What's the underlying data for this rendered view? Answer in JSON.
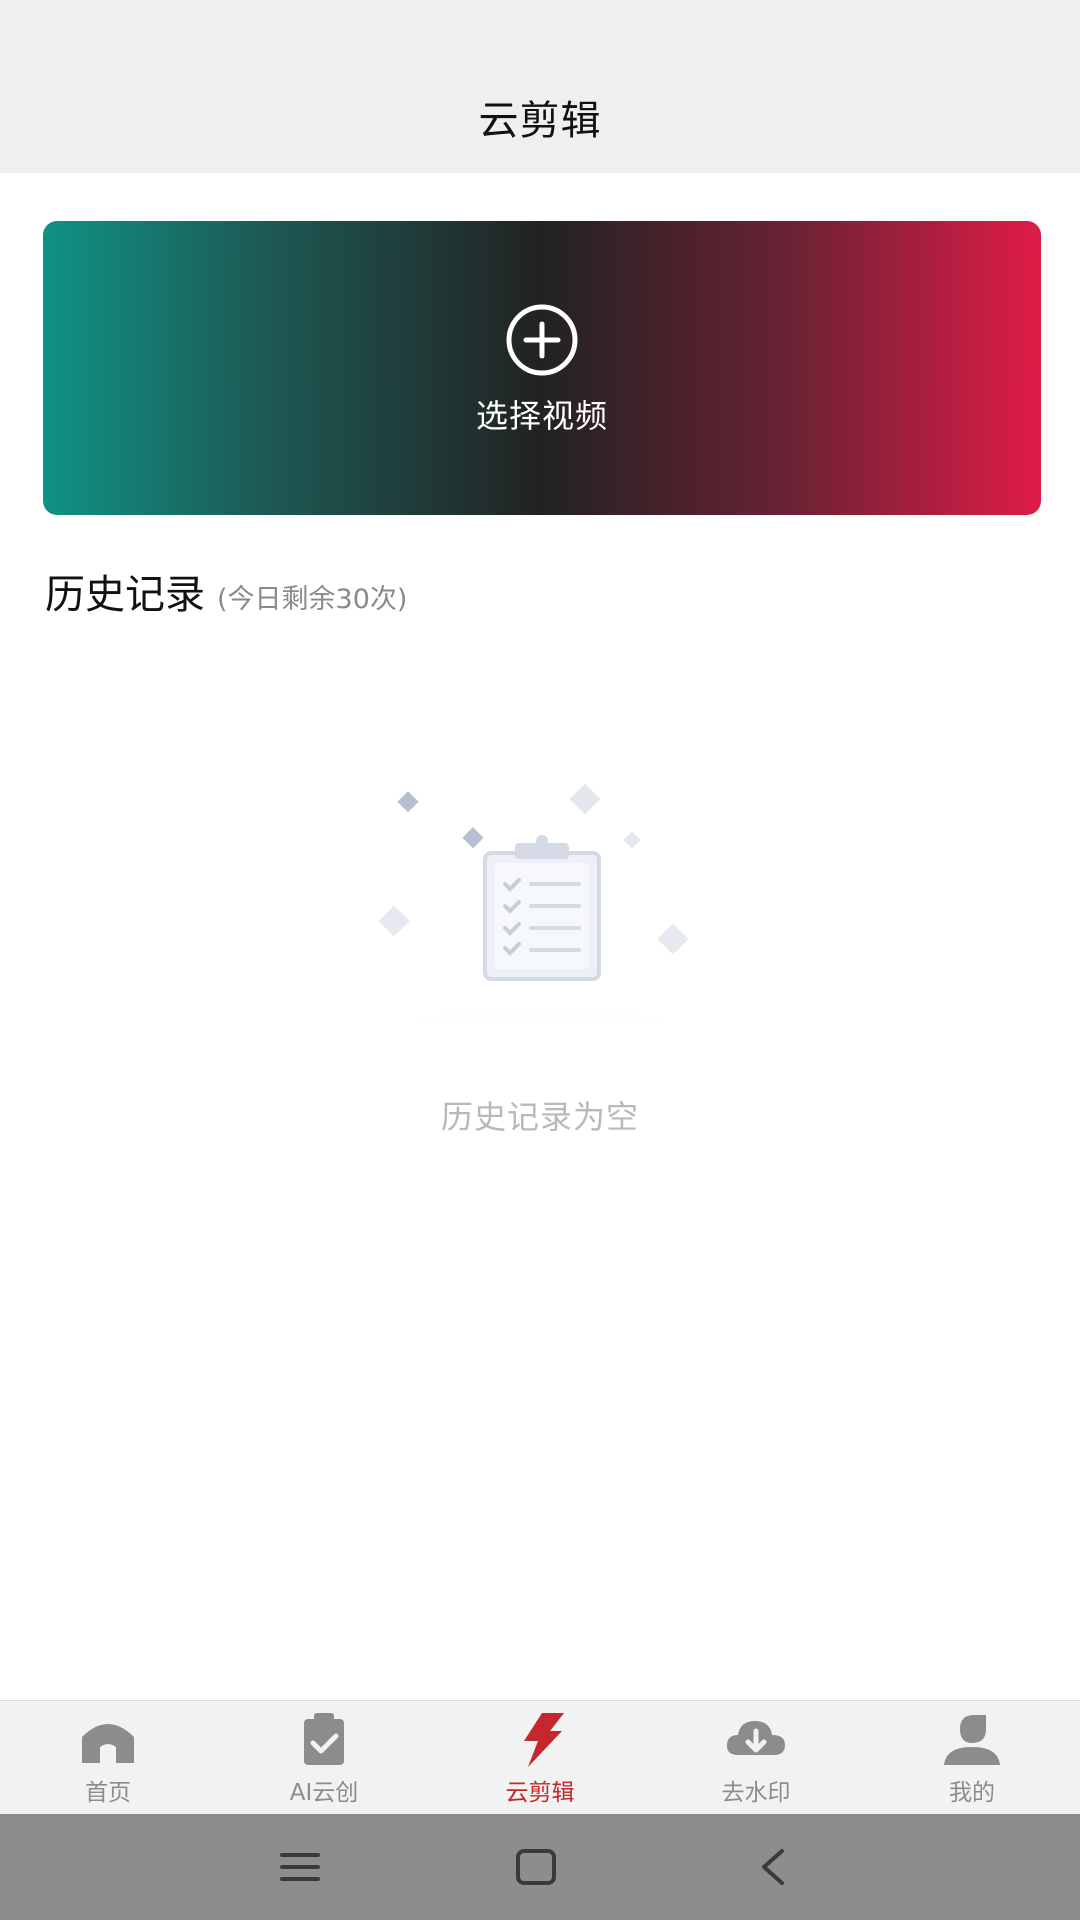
{
  "header": {
    "title": "云剪辑"
  },
  "select_card": {
    "label": "选择视频",
    "icon": "plus-circle-icon"
  },
  "history": {
    "title": "历史记录",
    "remaining": "(今日剩余30次)",
    "empty_text": "历史记录为空"
  },
  "tabbar": {
    "active_color": "#c4272c",
    "items": [
      {
        "label": "首页",
        "icon": "home-icon",
        "active": false
      },
      {
        "label": "AI云创",
        "icon": "clipboard-check-icon",
        "active": false
      },
      {
        "label": "云剪辑",
        "icon": "lightning-icon",
        "active": true
      },
      {
        "label": "去水印",
        "icon": "cloud-download-icon",
        "active": false
      },
      {
        "label": "我的",
        "icon": "user-icon",
        "active": false
      }
    ]
  },
  "system_nav": [
    "menu-icon",
    "home-square-icon",
    "back-icon"
  ]
}
